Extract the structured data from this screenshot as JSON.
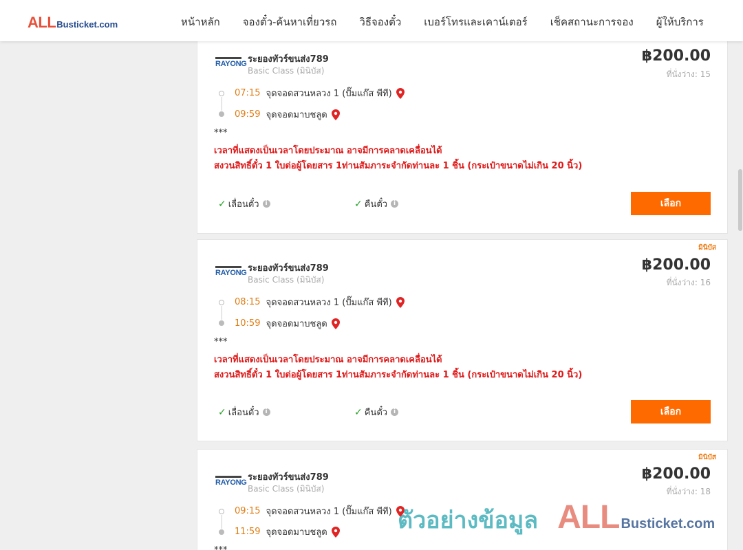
{
  "logo": {
    "prefix": "ALL",
    "suffix": "Busticket.com"
  },
  "nav": {
    "items": [
      "หน้าหลัก",
      "จองตั๋ว-ค้นหาเที่ยวรถ",
      "วิธีจองตั๋ว",
      "เบอร์โทรและเคาน์เตอร์",
      "เช็คสถานะการจอง",
      "ผู้ให้บริการ"
    ]
  },
  "colors": {
    "accent": "#ff6a00",
    "time": "#e07c12",
    "notice": "#e01818",
    "brand_red": "#e8503a",
    "brand_blue": "#234a8e"
  },
  "trips": [
    {
      "badge": "",
      "operator_logo": "RAYONG",
      "operator": "ระยองทัวร์ขนส่ง789",
      "class": "Basic Class (มินิบัส)",
      "price": "฿200.00",
      "seats": "ที่นั่งว่าง: 15",
      "depart_time": "07:15",
      "depart_place": "จุดจอดสวนหลวง 1 (ปั๊มแก๊ส พีที)",
      "arrive_time": "09:59",
      "arrive_place": "จุดจอดมาบชลูด",
      "stars": "***",
      "notice_1": "เวลาที่แสดงเป็นเวลาโดยประมาณ อาจมีการคลาดเคลื่อนได้",
      "notice_2": "สงวนสิทธิ์ตั๋ว 1 ใบต่อผู้โดยสาร 1ท่านสัมภาระจำกัดท่านละ 1 ชิ้น (กระเป๋าขนาดไม่เกิน 20 นิ้ว)",
      "feature_1": "เลื่อนตั๋ว",
      "feature_2": "คืนตั๋ว",
      "select_label": "เลือก"
    },
    {
      "badge": "มินิบัส",
      "operator_logo": "RAYONG",
      "operator": "ระยองทัวร์ขนส่ง789",
      "class": "Basic Class (มินิบัส)",
      "price": "฿200.00",
      "seats": "ที่นั่งว่าง: 16",
      "depart_time": "08:15",
      "depart_place": "จุดจอดสวนหลวง 1 (ปั๊มแก๊ส พีที)",
      "arrive_time": "10:59",
      "arrive_place": "จุดจอดมาบชลูด",
      "stars": "***",
      "notice_1": "เวลาที่แสดงเป็นเวลาโดยประมาณ อาจมีการคลาดเคลื่อนได้",
      "notice_2": "สงวนสิทธิ์ตั๋ว 1 ใบต่อผู้โดยสาร 1ท่านสัมภาระจำกัดท่านละ 1 ชิ้น (กระเป๋าขนาดไม่เกิน 20 นิ้ว)",
      "feature_1": "เลื่อนตั๋ว",
      "feature_2": "คืนตั๋ว",
      "select_label": "เลือก"
    },
    {
      "badge": "มินิบัส",
      "operator_logo": "RAYONG",
      "operator": "ระยองทัวร์ขนส่ง789",
      "class": "Basic Class (มินิบัส)",
      "price": "฿200.00",
      "seats": "ที่นั่งว่าง: 18",
      "depart_time": "09:15",
      "depart_place": "จุดจอดสวนหลวง 1 (ปั๊มแก๊ส พีที)",
      "arrive_time": "11:59",
      "arrive_place": "จุดจอดมาบชลูด",
      "stars": "***"
    }
  ],
  "watermark": {
    "thai": "ตัวอย่างข้อมูล",
    "brand_prefix": "ALL",
    "brand_suffix": "Busticket.com"
  }
}
